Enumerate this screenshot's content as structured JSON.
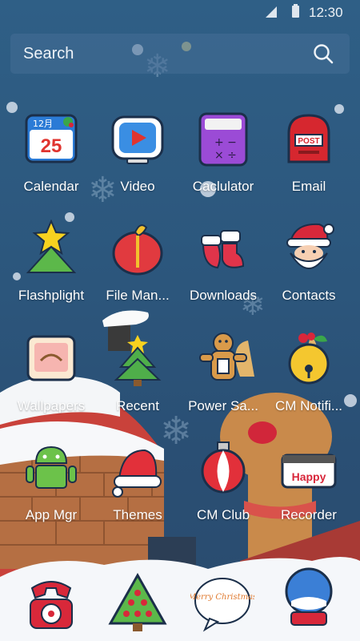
{
  "status_bar": {
    "time": "12:30"
  },
  "search": {
    "placeholder": "Search"
  },
  "apps": [
    {
      "label": "Calendar",
      "icon": "calendar-icon",
      "date": "25",
      "month": "12月"
    },
    {
      "label": "Video",
      "icon": "video-icon"
    },
    {
      "label": "Caclulator",
      "icon": "calculator-icon"
    },
    {
      "label": "Email",
      "icon": "mailbox-icon",
      "sign": "POST"
    },
    {
      "label": "Flashplight",
      "icon": "star-tree-icon"
    },
    {
      "label": "File Man...",
      "icon": "gift-sack-icon"
    },
    {
      "label": "Downloads",
      "icon": "stocking-icon"
    },
    {
      "label": "Contacts",
      "icon": "santa-icon"
    },
    {
      "label": "Wallpapers",
      "icon": "picture-frame-icon"
    },
    {
      "label": "Recent",
      "icon": "christmas-tree-icon"
    },
    {
      "label": "Power  Sa...",
      "icon": "gingerbread-icon"
    },
    {
      "label": "CM Notifi...",
      "icon": "bell-icon"
    },
    {
      "label": "App Mgr",
      "icon": "android-icon"
    },
    {
      "label": "Themes",
      "icon": "santa-hat-icon"
    },
    {
      "label": "CM Club",
      "icon": "ornament-icon"
    },
    {
      "label": "Recorder",
      "icon": "happy-sign-icon",
      "sign": "Happy"
    }
  ],
  "dock": [
    {
      "name": "phone",
      "icon": "telephone-icon"
    },
    {
      "name": "apps",
      "icon": "tree-apps-icon"
    },
    {
      "name": "messages",
      "icon": "speech-bubble-icon",
      "text": "Merry Christmas"
    },
    {
      "name": "browser",
      "icon": "snow-globe-icon"
    }
  ]
}
